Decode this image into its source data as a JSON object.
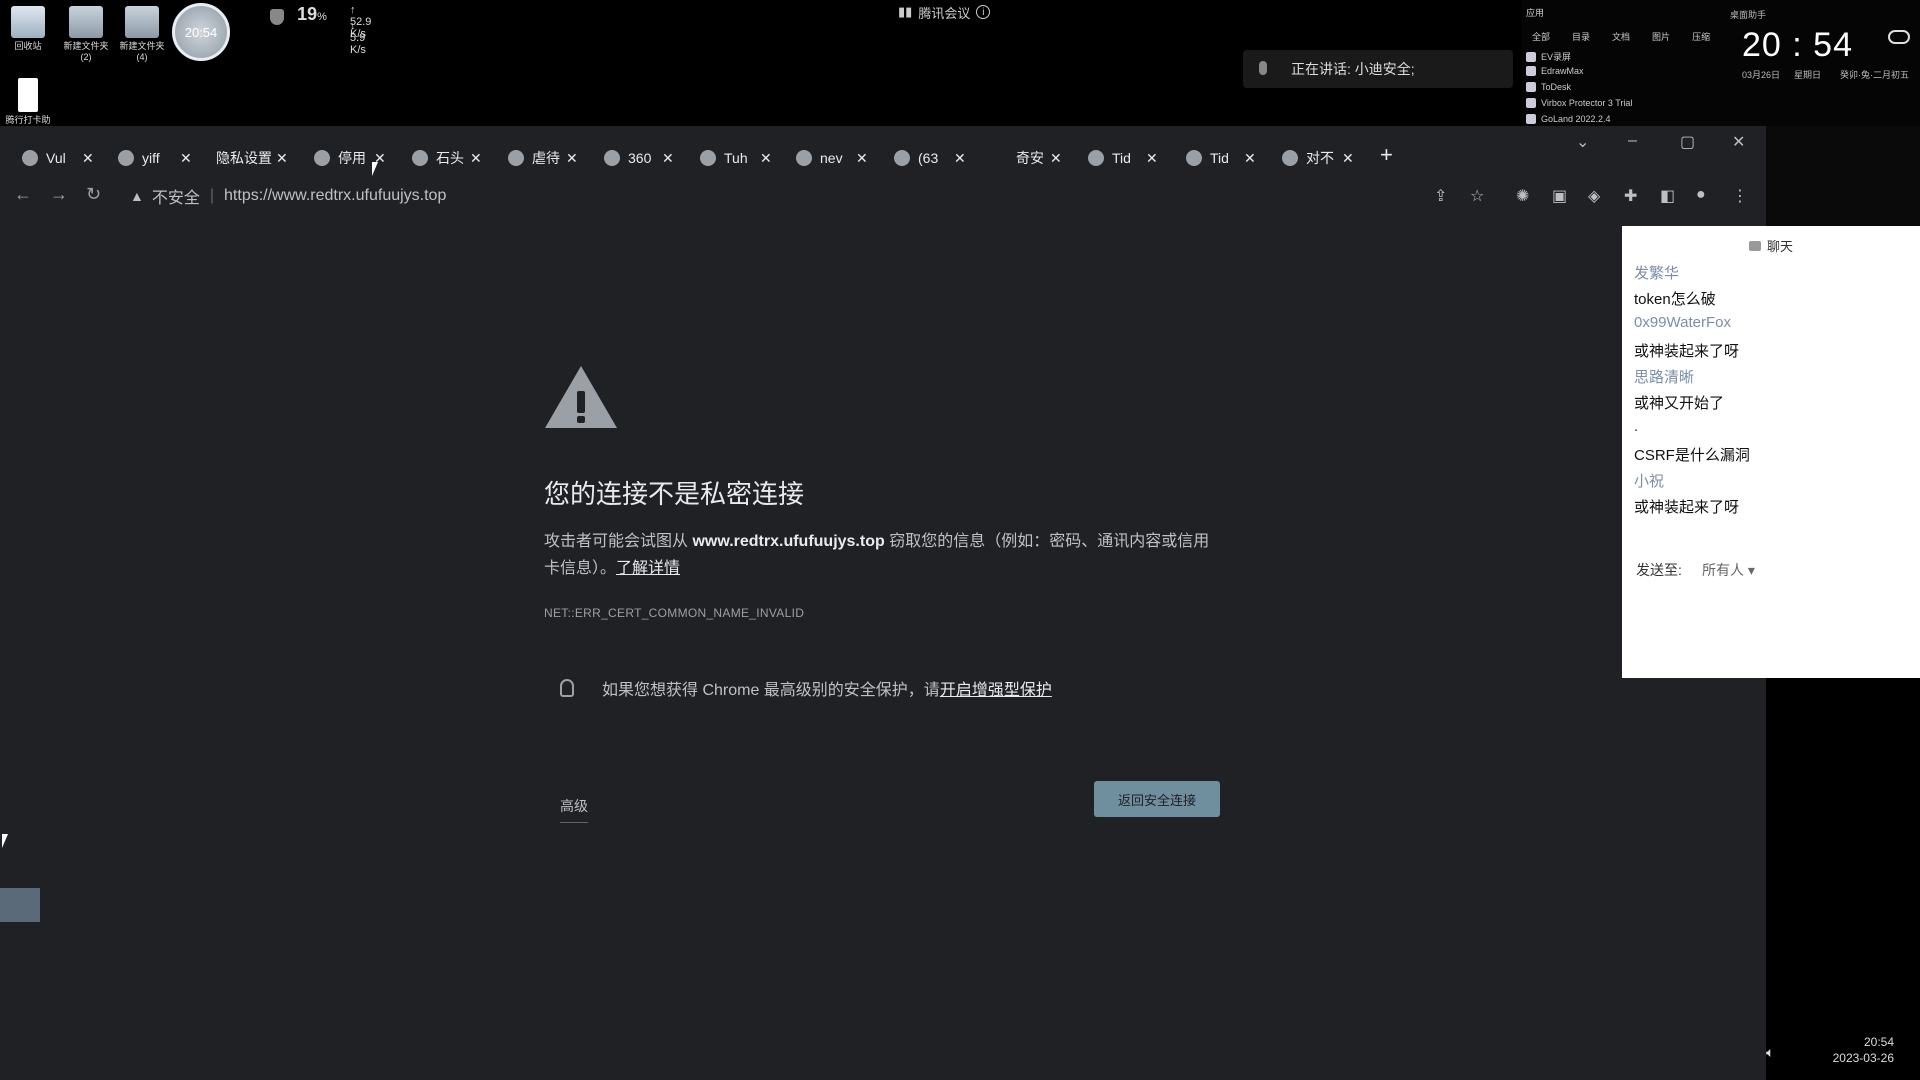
{
  "desktop": {
    "icons": [
      {
        "label": "回收站"
      },
      {
        "label": "新建文件夹\n(2)"
      },
      {
        "label": "新建文件夹\n(4)"
      }
    ],
    "clock_badge": "20:54",
    "net": {
      "percent": "19",
      "unit": "%",
      "up": "52.9",
      "down": "5.9",
      "rate_unit": "K/s"
    },
    "extra_icon_label": "腾行打卡助手"
  },
  "meeting": {
    "title": "腾讯会议",
    "talking": "正在讲话: 小迪安全;"
  },
  "apps_panel": {
    "header": "应用",
    "tabs": [
      "全部",
      "目录",
      "文档",
      "图片",
      "压缩"
    ],
    "items": [
      "EV录屏",
      "EdrawMax",
      "ToDesk",
      "Virbox Protector 3 Trial",
      "GoLand 2022.2.4"
    ]
  },
  "clock_panel": {
    "time": "20 : 54",
    "date": "03月26日",
    "weekday": "星期日",
    "lunar": "癸卯·兔·二月初五",
    "header": "桌面助手"
  },
  "tabs": [
    {
      "label": "Vul"
    },
    {
      "label": "yiff"
    },
    {
      "label": "隐私设置"
    },
    {
      "label": "停用"
    },
    {
      "label": "石头"
    },
    {
      "label": "虐待"
    },
    {
      "label": "360"
    },
    {
      "label": "Tuh"
    },
    {
      "label": "nev"
    },
    {
      "label": "(63"
    },
    {
      "label": "奇安"
    },
    {
      "label": "Tid"
    },
    {
      "label": "Tid"
    },
    {
      "label": "对不"
    }
  ],
  "omnibox": {
    "security": "不安全",
    "url": "https://www.redtrx.ufufuujys.top"
  },
  "error": {
    "title": "您的连接不是私密连接",
    "desc_prefix": "攻击者可能会试图从 ",
    "desc_host": "www.redtrx.ufufuujys.top",
    "desc_suffix": " 窃取您的信息（例如：密码、通讯内容或信用卡信息）。",
    "learn_more": "了解详情",
    "code": "NET::ERR_CERT_COMMON_NAME_INVALID",
    "protect_text": "如果您想获得 Chrome 最高级别的安全保护，请",
    "protect_link": "开启增强型保护",
    "advanced": "高级",
    "back": "返回安全连接"
  },
  "chat": {
    "header": "聊天",
    "messages": [
      {
        "name": "发繁华",
        "text": "token怎么破"
      },
      {
        "name": "0x99WaterFox",
        "text": "或神装起来了呀"
      },
      {
        "name": "思路清晰",
        "text": "或神又开始了"
      },
      {
        "name": ".",
        "text": "CSRF是什么漏洞"
      },
      {
        "name": "小祝",
        "text": "或神装起来了呀"
      }
    ],
    "send_to_label": "发送至:",
    "send_to_value": "所有人 ▾"
  },
  "taskbar": {
    "time": "20:54",
    "date": "2023-03-26"
  }
}
